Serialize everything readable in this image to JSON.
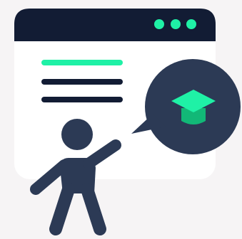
{
  "illustration": {
    "window": {
      "titlebar_dots": 3,
      "text_lines": [
        {
          "role": "highlight-line"
        },
        {
          "role": "body-line"
        },
        {
          "role": "body-line"
        }
      ]
    },
    "speech_bubble": {
      "icon": "graduation-cap-icon"
    },
    "figure": {
      "icon": "presenter-person-icon"
    }
  },
  "colors": {
    "background": "#f6f4f5",
    "window_body": "#ffffff",
    "navy": "#121c34",
    "slate": "#2c3a55",
    "accent": "#1ff1a6",
    "accent_shadow": "#12b877"
  }
}
